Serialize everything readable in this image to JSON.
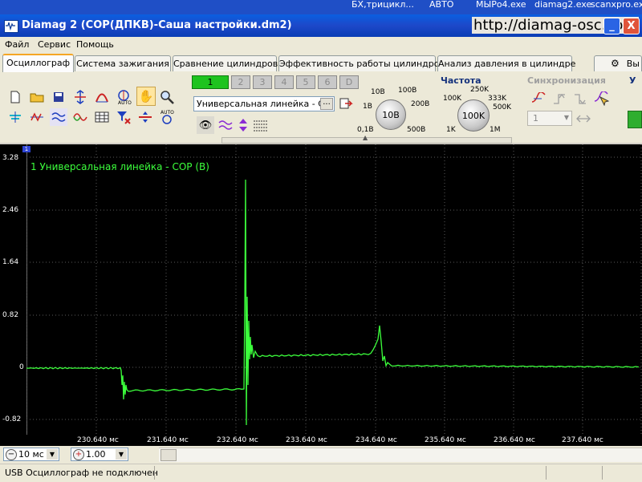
{
  "taskbar": {
    "items": [
      "БХ,трицикл...",
      "АВТО",
      "МЫРо4.exe",
      "diamag2.exe",
      "scanxpro.ex"
    ]
  },
  "window": {
    "title": "Diamag 2 (СОР(ДПКВ)-Саша настройки.dm2)",
    "url": "http://diamag-osc.com",
    "minimize": "_",
    "close": "X"
  },
  "menu": [
    "Файл",
    "Сервис",
    "Помощь"
  ],
  "tabs": [
    {
      "label": "Осциллограф",
      "active": true
    },
    {
      "label": "Система зажигания",
      "active": false
    },
    {
      "label": "Сравнение цилиндров",
      "active": false
    },
    {
      "label": "Эффективность работы цилиндров",
      "active": false
    },
    {
      "label": "Анализ давления в цилиндре",
      "active": false
    },
    {
      "label": "Вы",
      "active": false
    }
  ],
  "channels": [
    {
      "label": "1",
      "active": true
    },
    {
      "label": "2",
      "active": false
    },
    {
      "label": "3",
      "active": false
    },
    {
      "label": "4",
      "active": false
    },
    {
      "label": "5",
      "active": false
    },
    {
      "label": "6",
      "active": false
    },
    {
      "label": "D",
      "active": false
    }
  ],
  "probe_select": {
    "value": "Универсальная линейка - СО",
    "button": "..."
  },
  "voltage": {
    "labels": [
      "10В",
      "100В",
      "1В",
      "200В",
      "0,1В",
      "500В"
    ],
    "value": "10В"
  },
  "frequency": {
    "title": "Частота",
    "labels": [
      "250K",
      "100K",
      "333K",
      "500K",
      "1K",
      "1M"
    ],
    "value": "100K"
  },
  "sync": {
    "title": "Синхронизация",
    "channel": "1"
  },
  "extra_section_title": "У",
  "plot": {
    "trace_label": "1 Универсальная линейка - СОР (В)",
    "channel_marker": "1",
    "y_ticks": [
      "3.28",
      "2.46",
      "1.64",
      "0.82",
      "0",
      "-0.82"
    ],
    "x_ticks": [
      "230.640 мс",
      "231.640 мс",
      "232.640 мс",
      "233.640 мс",
      "234.640 мс",
      "235.640 мс",
      "236.640 мс",
      "237.640 мс"
    ],
    "trace_color": "#3cff3c",
    "grid_color": "#5a5a5a"
  },
  "bottom": {
    "time_div": "10 мс",
    "zoom": "1.00"
  },
  "status": {
    "text": "USB Осциллограф не подключен"
  }
}
